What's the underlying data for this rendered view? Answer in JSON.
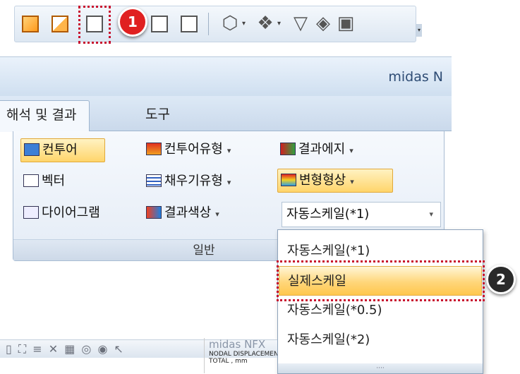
{
  "toolbar": {
    "dropdown_arrow": "▾",
    "grip": "▾"
  },
  "badges": {
    "one": "1",
    "two": "2"
  },
  "ribbon": {
    "app_title": "midas N",
    "tabs": [
      {
        "label": "해석 및 결과",
        "active": true
      },
      {
        "label": "도구",
        "active": false
      }
    ],
    "items": {
      "contour": "컨투어",
      "contour_type": "컨투어유형",
      "result_edge": "결과에지",
      "vector": "벡터",
      "fill_type": "채우기유형",
      "deformed_shape": "변형형상",
      "diagram": "다이어그램",
      "result_color": "결과색상",
      "combo_value": "자동스케일(*1)"
    },
    "group_label": "일반",
    "dropdown_arrow": "▾"
  },
  "popup": {
    "options": [
      "자동스케일(*1)",
      "실제스케일",
      "자동스케일(*0.5)",
      "자동스케일(*2)"
    ],
    "selected_index": 1,
    "grip": "····"
  },
  "bottom": {
    "logo": "midas NFX",
    "result_line1": "NODAL DISPLACEMENT",
    "result_line2": "TOTAL , mm"
  },
  "colors": {
    "highlight": "#ffd56b",
    "badge_red": "#e02020",
    "badge_dark": "#2a2a2a",
    "annotation_border": "#c8102e",
    "app_title": "#2e4c74"
  }
}
